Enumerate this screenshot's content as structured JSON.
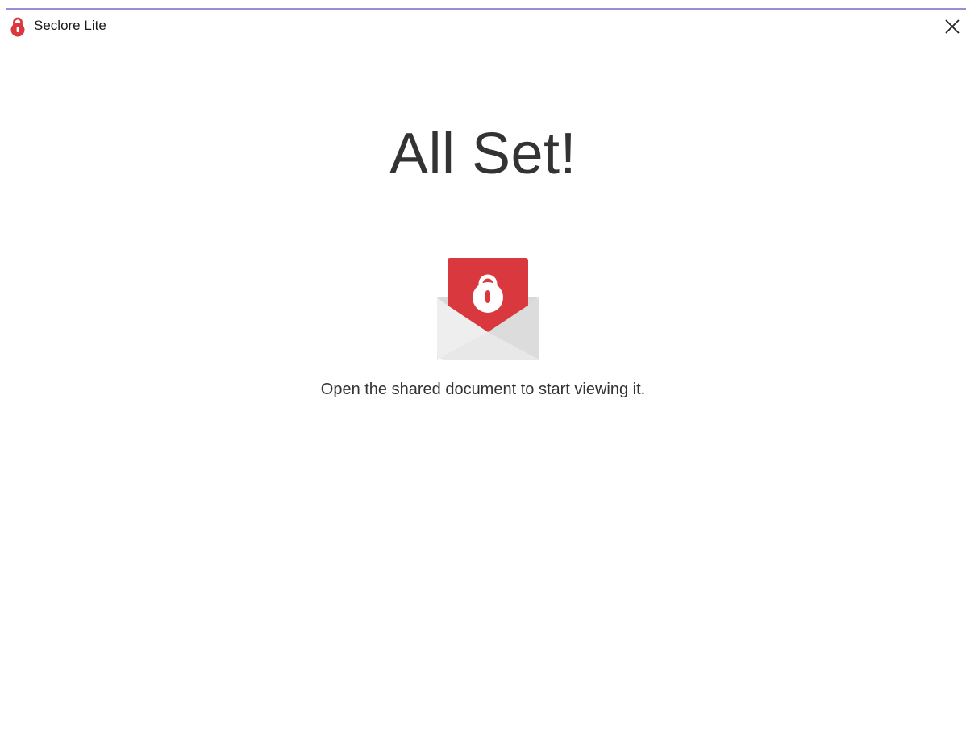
{
  "window": {
    "title": "Seclore Lite",
    "accent_color": "#d9393e",
    "border_color": "#9b8ed6",
    "icons": {
      "app": "padlock-icon",
      "close": "close-icon",
      "illustration": "envelope-lock-icon"
    }
  },
  "main": {
    "heading": "All Set!",
    "message": "Open the shared document to start viewing it."
  }
}
